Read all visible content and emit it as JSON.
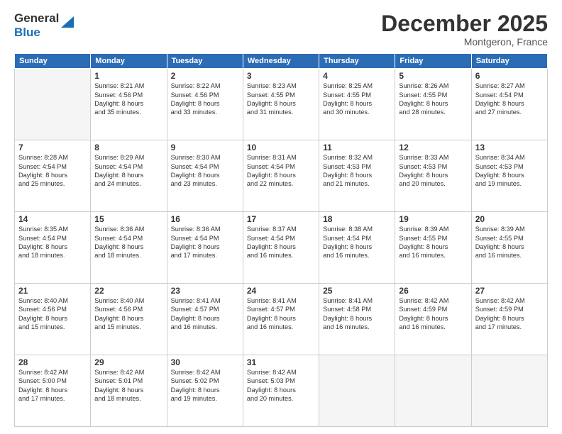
{
  "header": {
    "logo_general": "General",
    "logo_blue": "Blue",
    "month_title": "December 2025",
    "location": "Montgeron, France"
  },
  "weekdays": [
    "Sunday",
    "Monday",
    "Tuesday",
    "Wednesday",
    "Thursday",
    "Friday",
    "Saturday"
  ],
  "weeks": [
    [
      {
        "day": "",
        "info": ""
      },
      {
        "day": "1",
        "info": "Sunrise: 8:21 AM\nSunset: 4:56 PM\nDaylight: 8 hours\nand 35 minutes."
      },
      {
        "day": "2",
        "info": "Sunrise: 8:22 AM\nSunset: 4:56 PM\nDaylight: 8 hours\nand 33 minutes."
      },
      {
        "day": "3",
        "info": "Sunrise: 8:23 AM\nSunset: 4:55 PM\nDaylight: 8 hours\nand 31 minutes."
      },
      {
        "day": "4",
        "info": "Sunrise: 8:25 AM\nSunset: 4:55 PM\nDaylight: 8 hours\nand 30 minutes."
      },
      {
        "day": "5",
        "info": "Sunrise: 8:26 AM\nSunset: 4:55 PM\nDaylight: 8 hours\nand 28 minutes."
      },
      {
        "day": "6",
        "info": "Sunrise: 8:27 AM\nSunset: 4:54 PM\nDaylight: 8 hours\nand 27 minutes."
      }
    ],
    [
      {
        "day": "7",
        "info": "Sunrise: 8:28 AM\nSunset: 4:54 PM\nDaylight: 8 hours\nand 25 minutes."
      },
      {
        "day": "8",
        "info": "Sunrise: 8:29 AM\nSunset: 4:54 PM\nDaylight: 8 hours\nand 24 minutes."
      },
      {
        "day": "9",
        "info": "Sunrise: 8:30 AM\nSunset: 4:54 PM\nDaylight: 8 hours\nand 23 minutes."
      },
      {
        "day": "10",
        "info": "Sunrise: 8:31 AM\nSunset: 4:54 PM\nDaylight: 8 hours\nand 22 minutes."
      },
      {
        "day": "11",
        "info": "Sunrise: 8:32 AM\nSunset: 4:53 PM\nDaylight: 8 hours\nand 21 minutes."
      },
      {
        "day": "12",
        "info": "Sunrise: 8:33 AM\nSunset: 4:53 PM\nDaylight: 8 hours\nand 20 minutes."
      },
      {
        "day": "13",
        "info": "Sunrise: 8:34 AM\nSunset: 4:53 PM\nDaylight: 8 hours\nand 19 minutes."
      }
    ],
    [
      {
        "day": "14",
        "info": "Sunrise: 8:35 AM\nSunset: 4:54 PM\nDaylight: 8 hours\nand 18 minutes."
      },
      {
        "day": "15",
        "info": "Sunrise: 8:36 AM\nSunset: 4:54 PM\nDaylight: 8 hours\nand 18 minutes."
      },
      {
        "day": "16",
        "info": "Sunrise: 8:36 AM\nSunset: 4:54 PM\nDaylight: 8 hours\nand 17 minutes."
      },
      {
        "day": "17",
        "info": "Sunrise: 8:37 AM\nSunset: 4:54 PM\nDaylight: 8 hours\nand 16 minutes."
      },
      {
        "day": "18",
        "info": "Sunrise: 8:38 AM\nSunset: 4:54 PM\nDaylight: 8 hours\nand 16 minutes."
      },
      {
        "day": "19",
        "info": "Sunrise: 8:39 AM\nSunset: 4:55 PM\nDaylight: 8 hours\nand 16 minutes."
      },
      {
        "day": "20",
        "info": "Sunrise: 8:39 AM\nSunset: 4:55 PM\nDaylight: 8 hours\nand 16 minutes."
      }
    ],
    [
      {
        "day": "21",
        "info": "Sunrise: 8:40 AM\nSunset: 4:56 PM\nDaylight: 8 hours\nand 15 minutes."
      },
      {
        "day": "22",
        "info": "Sunrise: 8:40 AM\nSunset: 4:56 PM\nDaylight: 8 hours\nand 15 minutes."
      },
      {
        "day": "23",
        "info": "Sunrise: 8:41 AM\nSunset: 4:57 PM\nDaylight: 8 hours\nand 16 minutes."
      },
      {
        "day": "24",
        "info": "Sunrise: 8:41 AM\nSunset: 4:57 PM\nDaylight: 8 hours\nand 16 minutes."
      },
      {
        "day": "25",
        "info": "Sunrise: 8:41 AM\nSunset: 4:58 PM\nDaylight: 8 hours\nand 16 minutes."
      },
      {
        "day": "26",
        "info": "Sunrise: 8:42 AM\nSunset: 4:59 PM\nDaylight: 8 hours\nand 16 minutes."
      },
      {
        "day": "27",
        "info": "Sunrise: 8:42 AM\nSunset: 4:59 PM\nDaylight: 8 hours\nand 17 minutes."
      }
    ],
    [
      {
        "day": "28",
        "info": "Sunrise: 8:42 AM\nSunset: 5:00 PM\nDaylight: 8 hours\nand 17 minutes."
      },
      {
        "day": "29",
        "info": "Sunrise: 8:42 AM\nSunset: 5:01 PM\nDaylight: 8 hours\nand 18 minutes."
      },
      {
        "day": "30",
        "info": "Sunrise: 8:42 AM\nSunset: 5:02 PM\nDaylight: 8 hours\nand 19 minutes."
      },
      {
        "day": "31",
        "info": "Sunrise: 8:42 AM\nSunset: 5:03 PM\nDaylight: 8 hours\nand 20 minutes."
      },
      {
        "day": "",
        "info": ""
      },
      {
        "day": "",
        "info": ""
      },
      {
        "day": "",
        "info": ""
      }
    ]
  ]
}
